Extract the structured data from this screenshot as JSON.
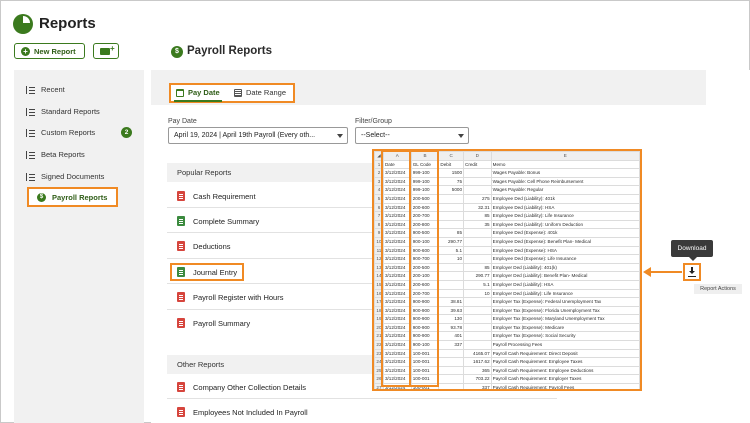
{
  "app": {
    "title": "Reports"
  },
  "toolbar": {
    "new_report_label": "New Report"
  },
  "page": {
    "title": "Payroll Reports"
  },
  "sidebar": {
    "items": [
      {
        "label": "Recent",
        "icon": "list-clock-icon"
      },
      {
        "label": "Standard Reports",
        "icon": "list-icon"
      },
      {
        "label": "Custom Reports",
        "icon": "user-list-icon",
        "badge": "2"
      },
      {
        "label": "Beta Reports",
        "icon": "flask-list-icon"
      },
      {
        "label": "Signed Documents",
        "icon": "signature-icon"
      },
      {
        "label": "Payroll Reports",
        "icon": "dollar-list-icon",
        "active": true
      }
    ]
  },
  "tabs": [
    {
      "label": "Pay Date",
      "icon": "calendar-icon",
      "active": true
    },
    {
      "label": "Date Range",
      "icon": "document-icon"
    }
  ],
  "filters": {
    "pay_date_label": "Pay Date",
    "pay_date_value": "April 19, 2024 | April 19th Payroll (Every oth...",
    "filter_group_label": "Filter/Group",
    "filter_group_value": "--Select--"
  },
  "popular": {
    "heading": "Popular Reports",
    "items": [
      {
        "label": "Cash Requirement",
        "type": "pdf"
      },
      {
        "label": "Complete Summary",
        "type": "xls"
      },
      {
        "label": "Deductions",
        "type": "pdf"
      },
      {
        "label": "Journal Entry",
        "type": "xls"
      },
      {
        "label": "Payroll Register with Hours",
        "type": "pdf"
      },
      {
        "label": "Payroll Summary",
        "type": "pdf"
      }
    ]
  },
  "other": {
    "heading": "Other Reports",
    "items": [
      {
        "label": "Company Other Collection Details",
        "type": "pdf"
      },
      {
        "label": "Employees Not Included In Payroll",
        "type": "pdf"
      }
    ]
  },
  "download": {
    "tooltip": "Download",
    "actions_label": "Report Actions"
  },
  "spreadsheet": {
    "columns": [
      "A",
      "B",
      "C",
      "D",
      "E"
    ],
    "header": [
      "Date",
      "GL Code",
      "Debit",
      "Credit",
      "Memo"
    ],
    "rows": [
      [
        "3/12/2024",
        "999-100",
        "1500",
        "",
        "Wages Payable: Bonus"
      ],
      [
        "3/12/2024",
        "999-100",
        "75",
        "",
        "Wages Payable: Cell Phone Reimbursement"
      ],
      [
        "3/12/2024",
        "999-100",
        "5000",
        "",
        "Wages Payable: Regular"
      ],
      [
        "3/12/2024",
        "200-500",
        "",
        "275",
        "Employee Ded (Liability): 401k"
      ],
      [
        "3/12/2024",
        "200-600",
        "",
        "32.31",
        "Employee Ded (Liability): HSA"
      ],
      [
        "3/12/2024",
        "200-700",
        "",
        "85",
        "Employee Ded (Liability): Life Insurance"
      ],
      [
        "3/12/2024",
        "200-800",
        "",
        "35",
        "Employee Ded (Liability): Uniform Deduction"
      ],
      [
        "3/12/2024",
        "900-500",
        "85",
        "",
        "Employee Ded (Expense): 401k"
      ],
      [
        "3/12/2024",
        "900-100",
        "290.77",
        "",
        "Employee Ded (Expense): Benefit Plan- Medical"
      ],
      [
        "3/12/2024",
        "900-600",
        "5.1",
        "",
        "Employee Ded (Expense): HSA"
      ],
      [
        "3/12/2024",
        "900-700",
        "10",
        "",
        "Employee Ded (Expense): Life Insurance"
      ],
      [
        "3/12/2024",
        "200-500",
        "",
        "85",
        "Employer Ded (Liability): 401(k)"
      ],
      [
        "3/12/2024",
        "200-100",
        "",
        "290.77",
        "Employer Ded (Liability): Benefit Plan- Medical"
      ],
      [
        "3/12/2024",
        "200-600",
        "",
        "5.1",
        "Employer Ded (Liability): HSA"
      ],
      [
        "3/12/2024",
        "200-700",
        "",
        "10",
        "Employer Ded (Liability): Life Insurance"
      ],
      [
        "3/12/2024",
        "900-900",
        "38.81",
        "",
        "Employer Tax (Expense): Federal Unemployment Tax"
      ],
      [
        "3/12/2024",
        "900-900",
        "39.63",
        "",
        "Employer Tax (Expense): Florida Unemployment Tax"
      ],
      [
        "3/12/2024",
        "900-900",
        "130",
        "",
        "Employer Tax (Expense): Maryland Unemployment Tax"
      ],
      [
        "3/12/2024",
        "900-900",
        "93.78",
        "",
        "Employer Tax (Expense): Medicare"
      ],
      [
        "3/12/2024",
        "900-900",
        "401",
        "",
        "Employer Tax (Expense): Social Security"
      ],
      [
        "3/12/2024",
        "900-100",
        "337",
        "",
        "Payroll Processing Fees"
      ],
      [
        "3/12/2024",
        "100-001",
        "",
        "4165.07",
        "Payroll Cash Requirement: Direct Deposit"
      ],
      [
        "3/12/2024",
        "100-001",
        "",
        "1617.62",
        "Payroll Cash Requirement: Employee Taxes"
      ],
      [
        "3/12/2024",
        "100-001",
        "",
        "365",
        "Payroll Cash Requirement: Employee Deductions"
      ],
      [
        "3/12/2024",
        "100-001",
        "",
        "703.22",
        "Payroll Cash Requirement: Employer Taxes"
      ],
      [
        "3/12/2024",
        "100-001",
        "",
        "337",
        "Payroll Cash Requirement: Payroll Fees"
      ]
    ]
  },
  "colors": {
    "brand": "#3b7a1e",
    "highlight": "#f08a24"
  }
}
